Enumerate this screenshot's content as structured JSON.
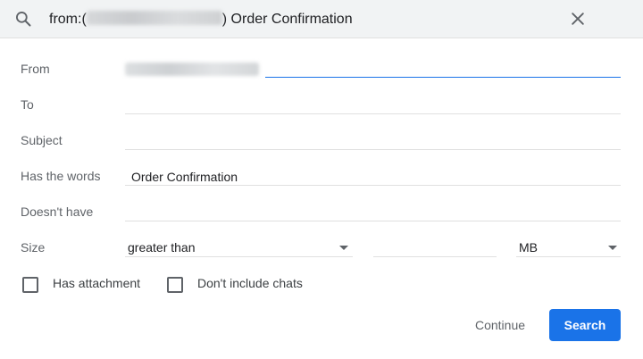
{
  "colors": {
    "accent": "#1a73e8",
    "topbar_bg": "#f1f3f4",
    "label": "#5f6368"
  },
  "header": {
    "search_icon": "search-icon",
    "query_prefix": "from:(",
    "query_suffix": ") Order Confirmation",
    "close_icon": "close-icon"
  },
  "form": {
    "from": {
      "label": "From",
      "value": ""
    },
    "to": {
      "label": "To",
      "value": ""
    },
    "subject": {
      "label": "Subject",
      "value": ""
    },
    "has_words": {
      "label": "Has the words",
      "value": "Order Confirmation"
    },
    "doesnt_have": {
      "label": "Doesn't have",
      "value": ""
    },
    "size": {
      "label": "Size",
      "comparator": "greater than",
      "amount": "",
      "unit": "MB"
    },
    "has_attachment": {
      "label": "Has attachment",
      "checked": false
    },
    "no_chats": {
      "label": "Don't include chats",
      "checked": false
    }
  },
  "actions": {
    "continue_label": "Continue",
    "search_label": "Search"
  }
}
